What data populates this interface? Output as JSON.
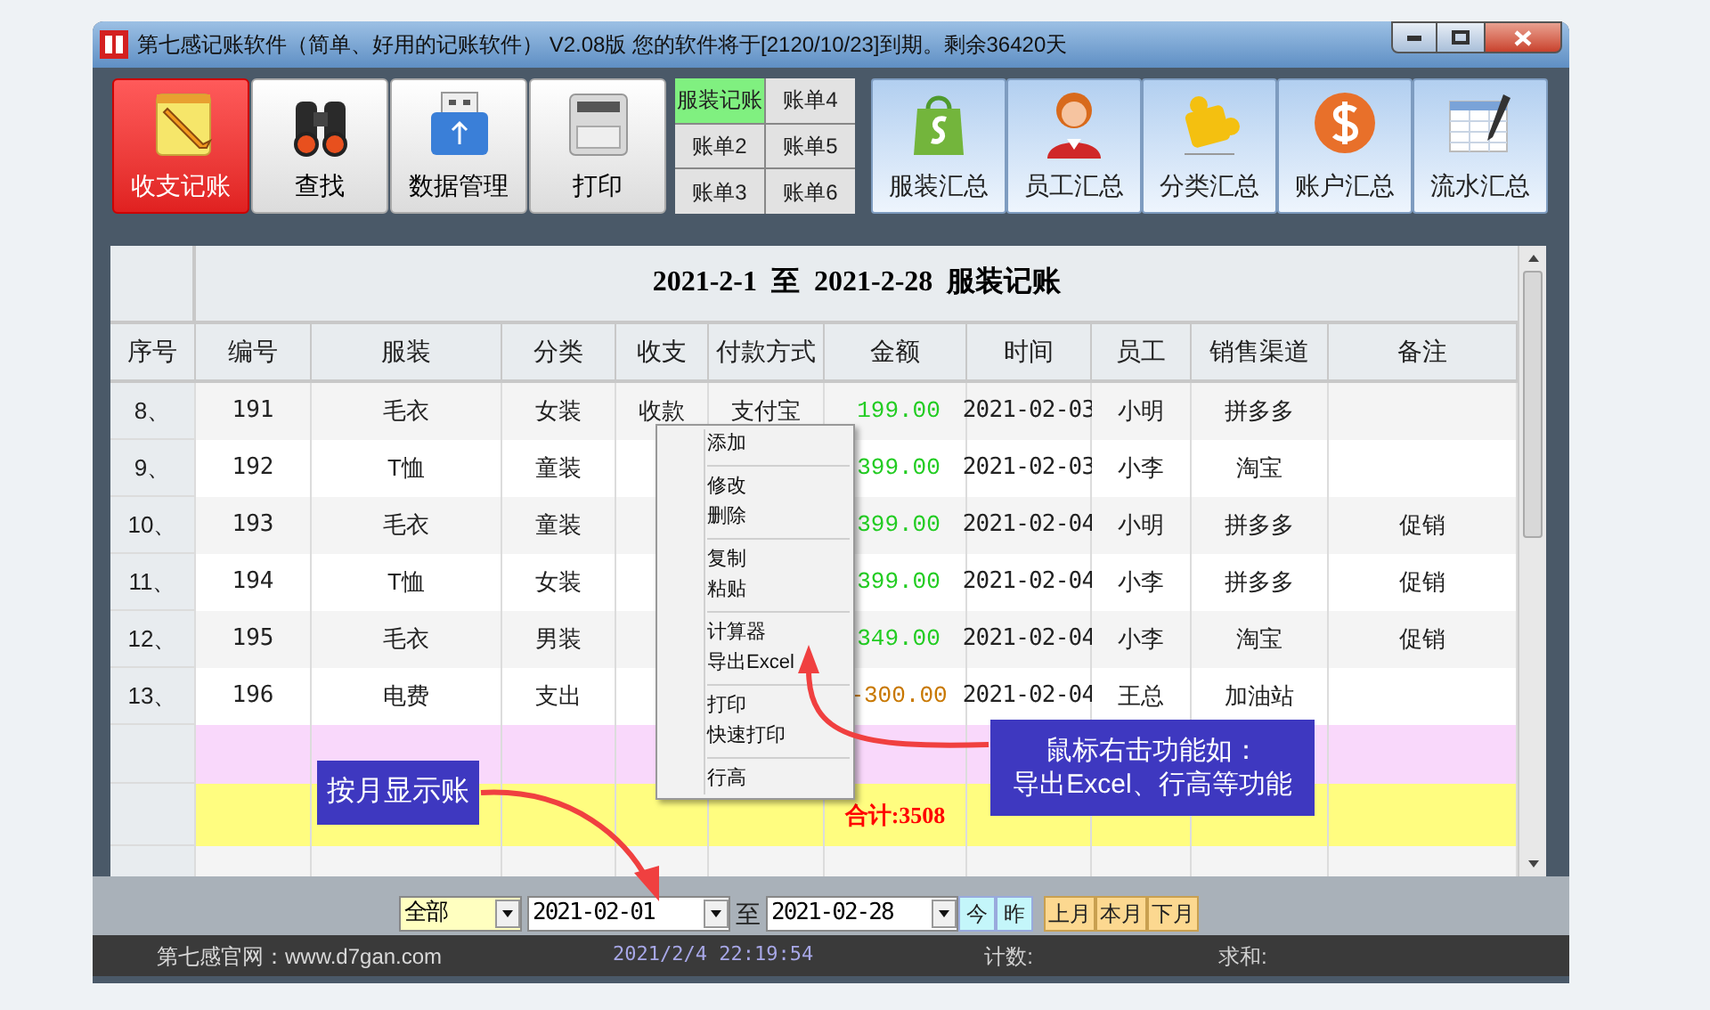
{
  "window": {
    "title": "第七感记账软件（简单、好用的记账软件） V2.08版 您的软件将于[2120/10/23]到期。剩余36420天"
  },
  "toolbar": {
    "tools": [
      {
        "label": "收支记账",
        "selected": true
      },
      {
        "label": "查找",
        "selected": false
      },
      {
        "label": "数据管理",
        "selected": false
      },
      {
        "label": "打印",
        "selected": false
      }
    ],
    "ledgers": [
      {
        "label": "服装记账",
        "selected": true
      },
      {
        "label": "账单4",
        "selected": false
      },
      {
        "label": "账单2",
        "selected": false
      },
      {
        "label": "账单5",
        "selected": false
      },
      {
        "label": "账单3",
        "selected": false
      },
      {
        "label": "账单6",
        "selected": false
      }
    ],
    "summaries": [
      {
        "label": "服装汇总"
      },
      {
        "label": "员工汇总"
      },
      {
        "label": "分类汇总"
      },
      {
        "label": "账户汇总"
      },
      {
        "label": "流水汇总"
      }
    ]
  },
  "table": {
    "title": "2021-2-1 至 2021-2-28 服装记账",
    "columns": [
      "序号",
      "编号",
      "服装",
      "分类",
      "收支",
      "付款方式",
      "金额",
      "时间",
      "员工",
      "销售渠道",
      "备注"
    ],
    "rows": [
      {
        "kind": "income",
        "cells": [
          "8、",
          "191",
          "毛衣",
          "女装",
          "收款",
          "支付宝",
          "199.00",
          "2021-02-03",
          "小明",
          "拼多多",
          null
        ]
      },
      {
        "kind": "income",
        "cells": [
          "9、",
          "192",
          "T恤",
          "童装",
          null,
          null,
          "399.00",
          "2021-02-03",
          "小李",
          "淘宝",
          null
        ]
      },
      {
        "kind": "income",
        "cells": [
          "10、",
          "193",
          "毛衣",
          "童装",
          null,
          null,
          "399.00",
          "2021-02-04",
          "小明",
          "拼多多",
          "促销"
        ]
      },
      {
        "kind": "income",
        "cells": [
          "11、",
          "194",
          "T恤",
          "女装",
          null,
          null,
          "399.00",
          "2021-02-04",
          "小李",
          "拼多多",
          "促销"
        ]
      },
      {
        "kind": "income",
        "cells": [
          "12、",
          "195",
          "毛衣",
          "男装",
          null,
          null,
          "349.00",
          "2021-02-04",
          "小李",
          "淘宝",
          "促销"
        ]
      },
      {
        "kind": "expense",
        "cells": [
          "13、",
          "196",
          "电费",
          "支出",
          null,
          null,
          "-300.00",
          "2021-02-04",
          "王总",
          "加油站",
          null
        ]
      },
      {
        "kind": "highlight"
      },
      {
        "kind": "total",
        "label": "合计:3508"
      },
      {
        "kind": "empty"
      }
    ]
  },
  "context_menu": {
    "groups": [
      [
        "添加"
      ],
      [
        "修改",
        "删除"
      ],
      [
        "复制",
        "粘贴"
      ],
      [
        "计算器",
        "导出Excel"
      ],
      [
        "打印",
        "快速打印"
      ],
      [
        "行高"
      ]
    ]
  },
  "filter_bar": {
    "scope": "全部",
    "from": "2021-02-01",
    "to_label": "至",
    "to": "2021-02-28",
    "quick_days": [
      "今",
      "昨"
    ],
    "quick_months": [
      "上月",
      "本月",
      "下月"
    ]
  },
  "status_bar": {
    "site": "第七感官网：www.d7gan.com",
    "time": "2021/2/4 22:19:54",
    "count": "计数:",
    "sum": "求和:"
  },
  "annotations": [
    {
      "lines": [
        "按月显示账"
      ]
    },
    {
      "lines": [
        "鼠标右击功能如：",
        "导出Excel、行高等功能"
      ]
    }
  ]
}
